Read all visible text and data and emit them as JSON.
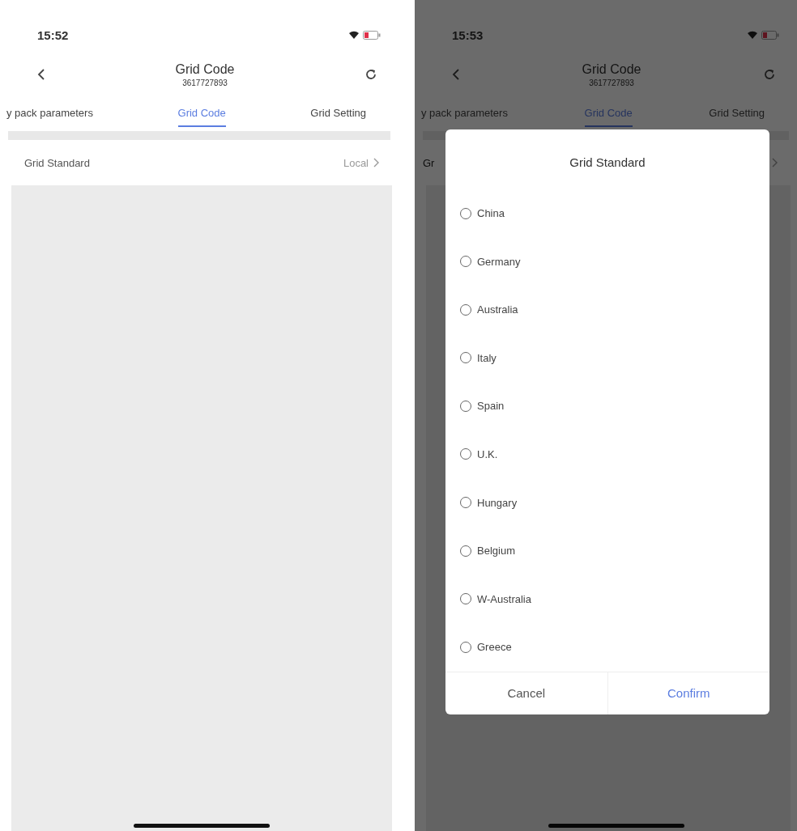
{
  "screens": [
    {
      "status_bar": {
        "time": "15:52"
      },
      "header": {
        "title": "Grid Code",
        "subtitle": "3617727893"
      },
      "tabs": [
        {
          "label": "y pack parameters",
          "selected": false
        },
        {
          "label": "Grid Code",
          "selected": true
        },
        {
          "label": "Grid Setting",
          "selected": false
        }
      ],
      "settings": [
        {
          "label": "Grid Standard",
          "value": "Local"
        }
      ]
    },
    {
      "status_bar": {
        "time": "15:53"
      },
      "header": {
        "title": "Grid Code",
        "subtitle": "3617727893"
      },
      "tabs": [
        {
          "label": "y pack parameters",
          "selected": false
        },
        {
          "label": "Grid Code",
          "selected": true
        },
        {
          "label": "Grid Setting",
          "selected": false
        }
      ],
      "settings": [
        {
          "label": "Gr"
        }
      ],
      "dialog": {
        "title": "Grid Standard",
        "options": [
          {
            "label": "China",
            "selected": false
          },
          {
            "label": "Germany",
            "selected": false
          },
          {
            "label": "Australia",
            "selected": false
          },
          {
            "label": "Italy",
            "selected": false
          },
          {
            "label": "Spain",
            "selected": false
          },
          {
            "label": "U.K.",
            "selected": false
          },
          {
            "label": "Hungary",
            "selected": false
          },
          {
            "label": "Belgium",
            "selected": false
          },
          {
            "label": "W-Australia",
            "selected": false
          },
          {
            "label": "Greece",
            "selected": false
          }
        ],
        "buttons": [
          {
            "label": "Cancel",
            "kind": "cancel"
          },
          {
            "label": "Confirm",
            "kind": "confirm"
          }
        ]
      }
    }
  ]
}
